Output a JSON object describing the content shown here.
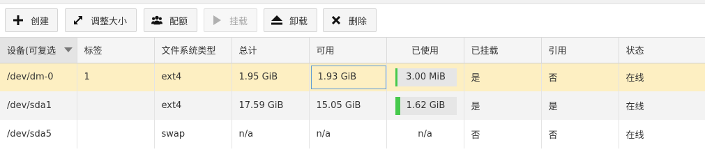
{
  "toolbar": {
    "create": "创建",
    "resize": "调整大小",
    "quota": "配额",
    "mount": "挂载",
    "unmount": "卸载",
    "delete": "删除"
  },
  "table": {
    "headers": {
      "device": "设备(可复选",
      "label": "标签",
      "fstype": "文件系统类型",
      "total": "总计",
      "available": "可用",
      "used": "已使用",
      "mounted": "已挂载",
      "referenced": "引用",
      "status": "状态"
    },
    "rows": [
      {
        "device": "/dev/dm-0",
        "label": "1",
        "fstype": "ext4",
        "total": "1.95 GiB",
        "available": "1.93 GiB",
        "used": "3.00 MiB",
        "used_fraction": 0.015,
        "mounted": "是",
        "referenced": "否",
        "status": "在线"
      },
      {
        "device": "/dev/sda1",
        "label": "",
        "fstype": "ext4",
        "total": "17.59 GiB",
        "available": "15.05 GiB",
        "used": "1.62 GiB",
        "used_fraction": 0.09,
        "mounted": "是",
        "referenced": "是",
        "status": "在线"
      },
      {
        "device": "/dev/sda5",
        "label": "",
        "fstype": "swap",
        "total": "n/a",
        "available": "n/a",
        "used": "n/a",
        "mounted": "否",
        "referenced": "否",
        "status": "在线"
      }
    ]
  },
  "colors": {
    "selected_row": "#fdefc2",
    "usage_fill": "#46c94c",
    "focus_border": "#5b9ad5"
  }
}
